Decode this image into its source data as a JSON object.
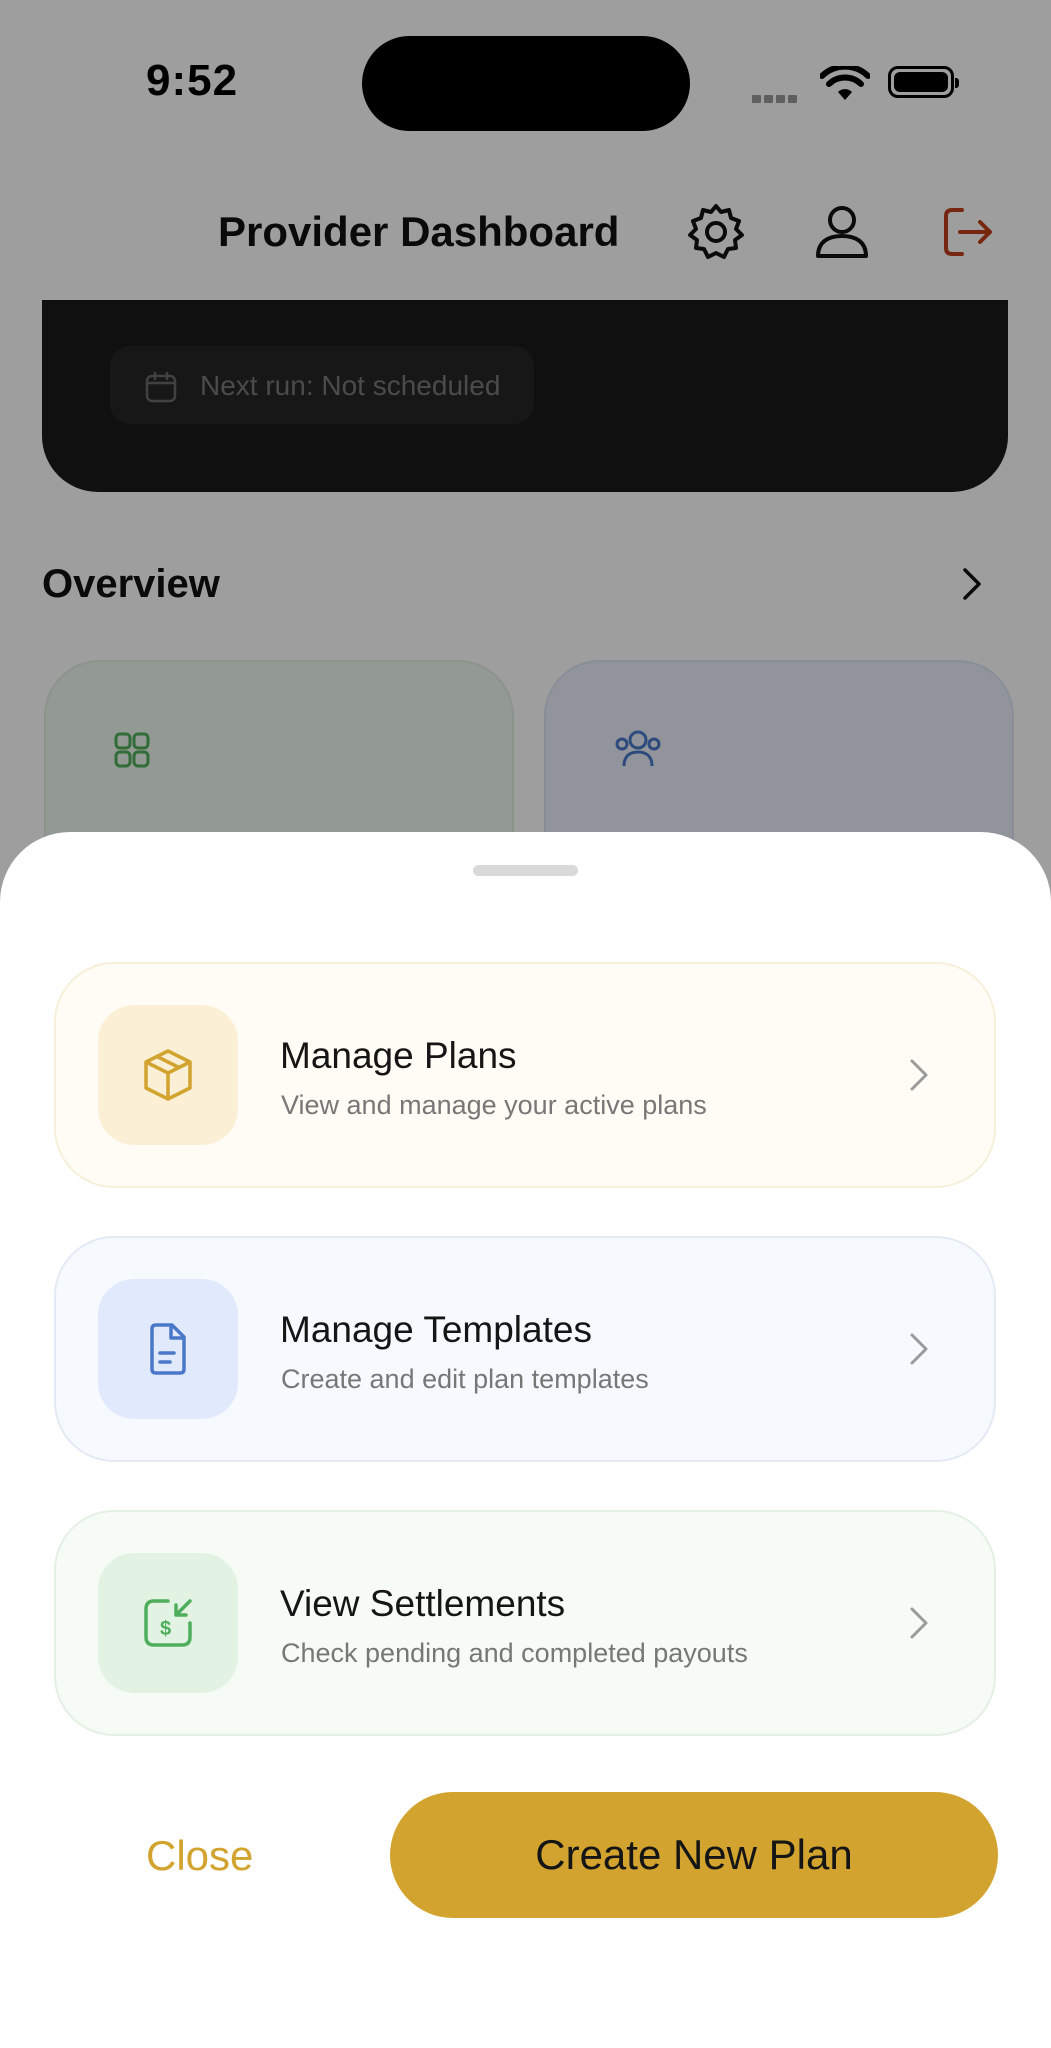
{
  "status_bar": {
    "time": "9:52"
  },
  "header": {
    "title": "Provider Dashboard"
  },
  "banner": {
    "next_run": "Next run: Not scheduled"
  },
  "overview": {
    "heading": "Overview"
  },
  "sheet": {
    "options": [
      {
        "title": "Manage Plans",
        "subtitle": "View and manage your active plans",
        "icon": "box-icon",
        "color": "#d2a32e"
      },
      {
        "title": "Manage Templates",
        "subtitle": "Create and edit plan templates",
        "icon": "document-icon",
        "color": "#4a78c9"
      },
      {
        "title": "View Settlements",
        "subtitle": "Check pending and completed payouts",
        "icon": "settlement-icon",
        "color": "#4fae5c"
      }
    ],
    "close_label": "Close",
    "create_label": "Create New Plan"
  },
  "colors": {
    "accent": "#d2a32e",
    "logout": "#c0401b"
  }
}
